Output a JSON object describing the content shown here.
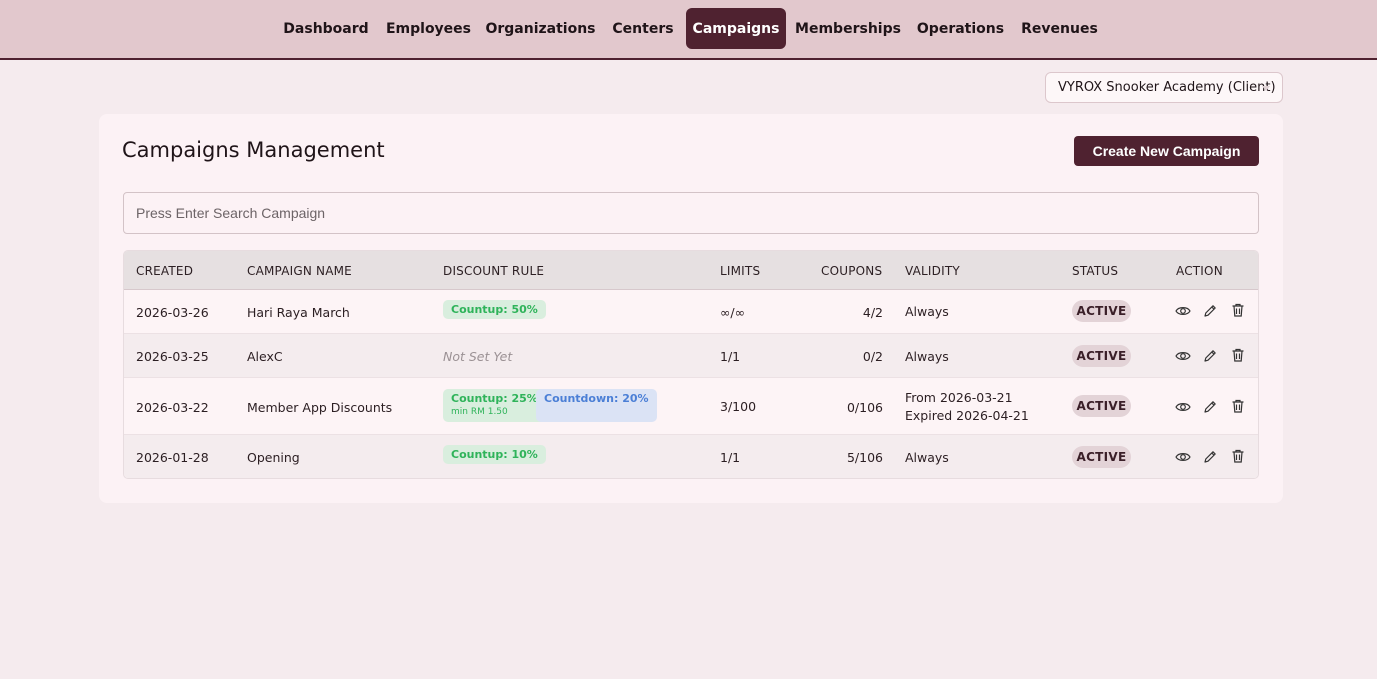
{
  "nav": {
    "tabs": [
      "Dashboard",
      "Employees",
      "Organizations",
      "Centers",
      "Campaigns",
      "Memberships",
      "Operations",
      "Revenues"
    ],
    "active": "Campaigns"
  },
  "client_selector": {
    "value": "VYROX Snooker Academy (Client)"
  },
  "page": {
    "title": "Campaigns Management",
    "create_label": "Create New Campaign",
    "search_placeholder": "Press Enter Search Campaign"
  },
  "table": {
    "headers": [
      "CREATED",
      "CAMPAIGN NAME",
      "DISCOUNT RULE",
      "LIMITS",
      "COUPONS",
      "VALIDITY",
      "STATUS",
      "ACTION"
    ],
    "rows": [
      {
        "created": "2026-03-26",
        "name": "Hari Raya March",
        "rules": [
          {
            "label": "Countup: 50%",
            "kind": "green"
          }
        ],
        "limits": "∞/∞",
        "coupons": "4/2",
        "validity": [
          "Always"
        ],
        "status": "ACTIVE"
      },
      {
        "created": "2026-03-25",
        "name": "AlexC",
        "rules_empty": "Not Set Yet",
        "limits": "1/1",
        "coupons": "0/2",
        "validity": [
          "Always"
        ],
        "status": "ACTIVE"
      },
      {
        "created": "2026-03-22",
        "name": "Member App Discounts",
        "rules": [
          {
            "label": "Countup: 25%",
            "sub": "min RM 1.50",
            "kind": "green"
          },
          {
            "label": "Countdown: 20%",
            "kind": "blue"
          }
        ],
        "limits": "3/100",
        "coupons": "0/106",
        "validity": [
          "From 2026-03-21",
          "Expired 2026-04-21"
        ],
        "status": "ACTIVE"
      },
      {
        "created": "2026-01-28",
        "name": "Opening",
        "rules": [
          {
            "label": "Countup: 10%",
            "kind": "green"
          }
        ],
        "limits": "1/1",
        "coupons": "5/106",
        "validity": [
          "Always"
        ],
        "status": "ACTIVE"
      }
    ]
  },
  "icons": {
    "view": "eye-icon",
    "edit": "pencil-icon",
    "delete": "trash-icon"
  }
}
